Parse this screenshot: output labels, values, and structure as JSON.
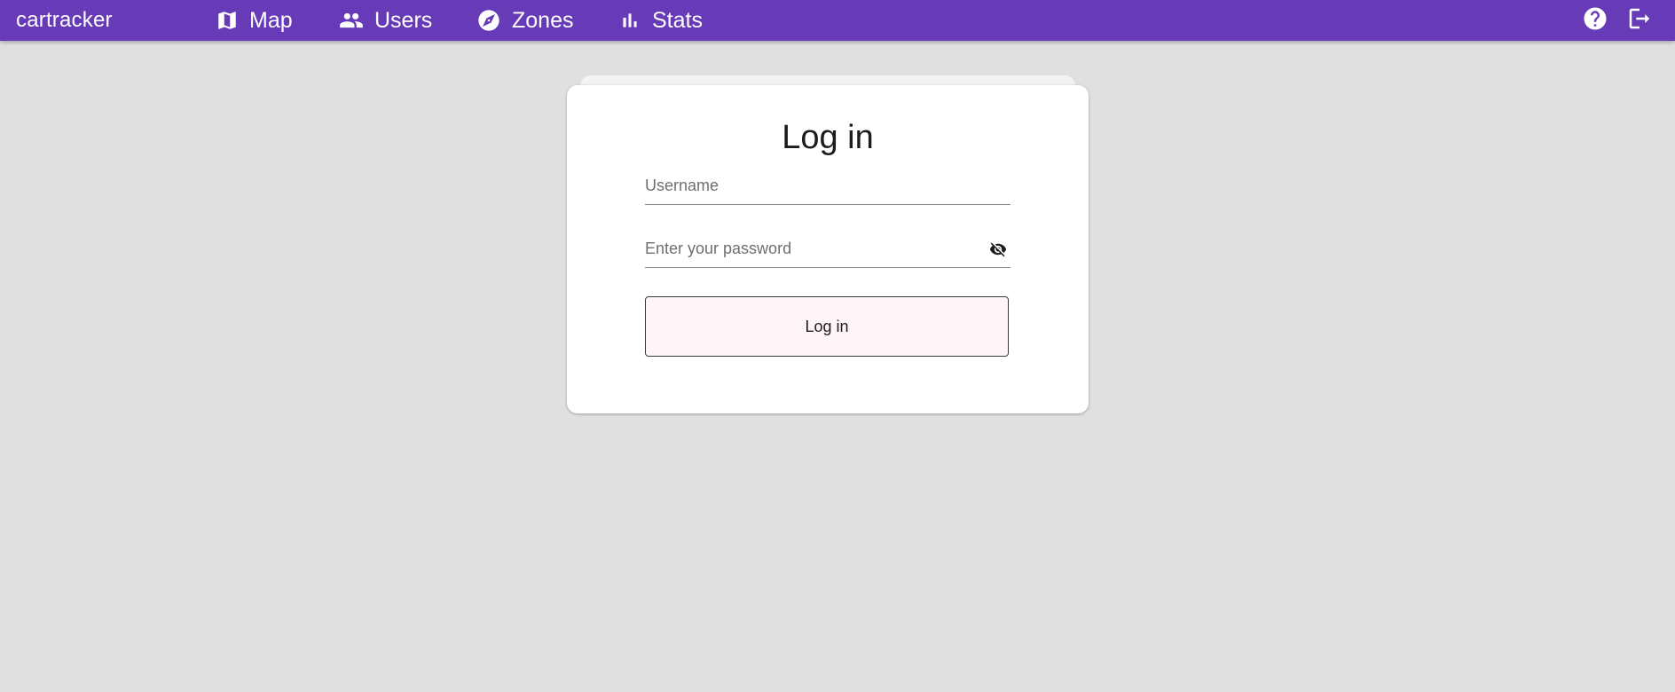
{
  "app": {
    "brand": "cartracker",
    "accent_color": "#673ab7",
    "background_color": "#e0e0e0"
  },
  "nav": {
    "items": [
      {
        "label": "Map",
        "icon": "map-icon"
      },
      {
        "label": "Users",
        "icon": "users-icon"
      },
      {
        "label": "Zones",
        "icon": "compass-icon"
      },
      {
        "label": "Stats",
        "icon": "bar-chart-icon"
      }
    ],
    "actions": [
      {
        "icon": "help-icon"
      },
      {
        "icon": "logout-icon"
      }
    ]
  },
  "login": {
    "title": "Log in",
    "username": {
      "value": "",
      "placeholder": "Username"
    },
    "password": {
      "value": "",
      "placeholder": "Enter your password",
      "toggle_icon": "visibility-off-icon"
    },
    "submit_label": "Log in",
    "button_color": "#fff5f8"
  }
}
